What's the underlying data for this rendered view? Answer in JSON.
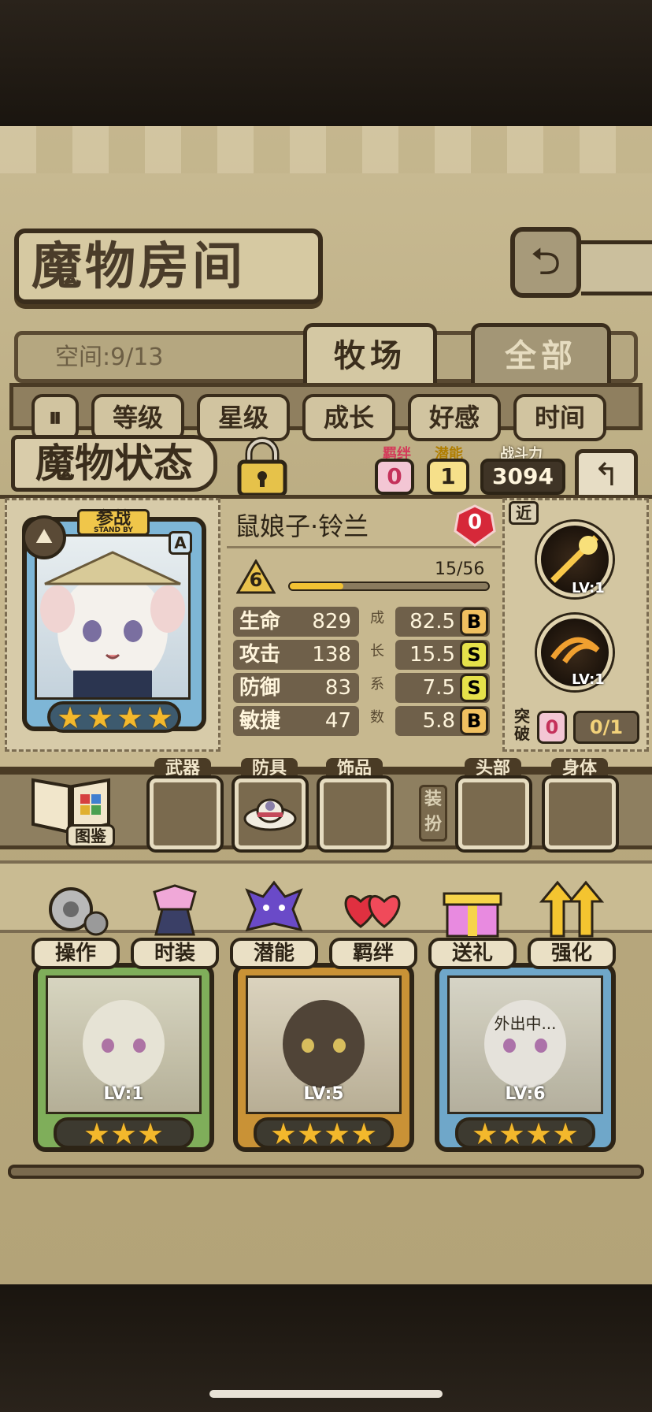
{
  "header": {
    "title": "魔物房间",
    "back_icon": "return-arrow-icon"
  },
  "tabs": {
    "space_label": "空间:9/13",
    "items": [
      {
        "label": "牧场",
        "active": true
      },
      {
        "label": "全部",
        "active": false
      }
    ]
  },
  "filters": {
    "pause_label": "⏸",
    "items": [
      "等级",
      "星级",
      "成长",
      "好感",
      "时间"
    ]
  },
  "status": {
    "title": "魔物状态",
    "bond_label": "羁绊",
    "bond_value": "0",
    "potential_label": "潜能",
    "potential_value": "1",
    "power_label": "战斗力",
    "power_value": "3094"
  },
  "monster": {
    "name": "鼠娘子·铃兰",
    "heart_value": "0",
    "rank": "A",
    "standby_label": "参战",
    "standby_sub": "STAND BY",
    "level": "6",
    "exp_text": "15/56",
    "exp_progress": 0.268,
    "stars": 4,
    "growth_label": [
      "成",
      "长",
      "系",
      "数"
    ],
    "stats": [
      {
        "label": "生命",
        "value": "829",
        "growth": "82.5",
        "grade": "B"
      },
      {
        "label": "攻击",
        "value": "138",
        "growth": "15.5",
        "grade": "S"
      },
      {
        "label": "防御",
        "value": "83",
        "growth": "7.5",
        "grade": "S"
      },
      {
        "label": "敏捷",
        "value": "47",
        "growth": "5.8",
        "grade": "B"
      }
    ],
    "range_label": "近",
    "skills": [
      {
        "level": "LV:1"
      },
      {
        "level": "LV:1"
      }
    ],
    "breakthrough_label": "突破",
    "breakthrough_value": "0",
    "breakthrough_progress": "0/1"
  },
  "equipment": {
    "book_label": "图鉴",
    "weapon": "武器",
    "armor": "防具",
    "accessory": "饰品",
    "dress_label": "装扮",
    "head": "头部",
    "body": "身体"
  },
  "menu": [
    {
      "label": "操作",
      "icon": "gear-icon"
    },
    {
      "label": "时装",
      "icon": "outfit-icon"
    },
    {
      "label": "潜能",
      "icon": "potential-icon"
    },
    {
      "label": "羁绊",
      "icon": "hearts-icon"
    },
    {
      "label": "送礼",
      "icon": "gift-icon"
    },
    {
      "label": "强化",
      "icon": "upgrade-arrows-icon"
    }
  ],
  "monster_list": [
    {
      "level": "LV:1",
      "stars": 3,
      "frame": "#7fae5a",
      "note": ""
    },
    {
      "level": "LV:5",
      "stars": 4,
      "frame": "#c99236",
      "note": ""
    },
    {
      "level": "LV:6",
      "stars": 4,
      "frame": "#6fa7c9",
      "note": "外出中..."
    }
  ],
  "colors": {
    "grade_B": "#f0c060",
    "grade_S": "#e6e14a",
    "heart": "#d62839",
    "exp_bar": "#f2c233"
  }
}
